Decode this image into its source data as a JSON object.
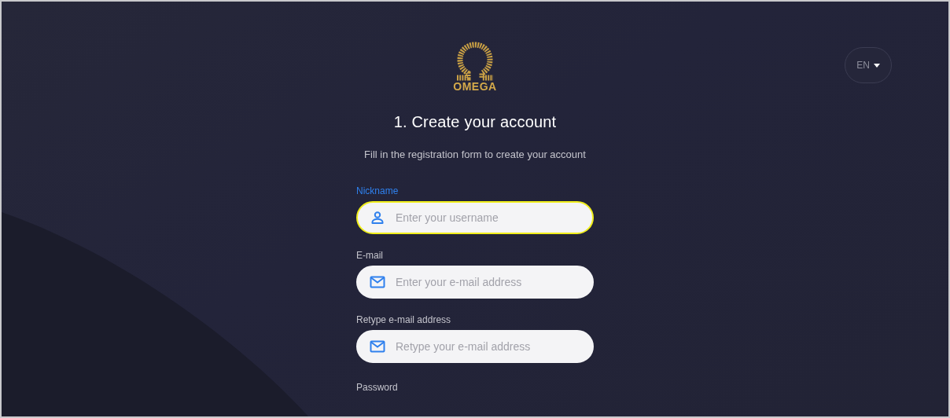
{
  "logo": {
    "text": "OMEGA"
  },
  "language": {
    "label": "EN"
  },
  "title": "1. Create your account",
  "subtitle": "Fill in the registration form to create your account",
  "fields": [
    {
      "label": "Nickname",
      "placeholder": "Enter your username",
      "kind": "user",
      "focused": true
    },
    {
      "label": "E-mail",
      "placeholder": "Enter your e-mail address",
      "kind": "mail",
      "focused": false
    },
    {
      "label": "Retype e-mail address",
      "placeholder": "Retype your e-mail address",
      "kind": "mail",
      "focused": false
    }
  ],
  "next_label": "Password"
}
